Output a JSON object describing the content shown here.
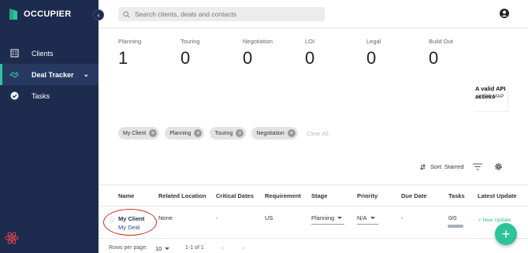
{
  "brand": {
    "name": "OCCUPIER"
  },
  "sidebar": {
    "items": [
      {
        "label": "Clients",
        "icon": "building-icon"
      },
      {
        "label": "Deal Tracker",
        "icon": "handshake-icon"
      },
      {
        "label": "Tasks",
        "icon": "check-circle-icon"
      }
    ]
  },
  "search": {
    "placeholder": "Search clients, deals and contacts"
  },
  "stages": [
    {
      "label": "Planning",
      "count": "1"
    },
    {
      "label": "Touring",
      "count": "0"
    },
    {
      "label": "Negotiation",
      "count": "0"
    },
    {
      "label": "LOI",
      "count": "0"
    },
    {
      "label": "Legal",
      "count": "0"
    },
    {
      "label": "Build Out",
      "count": "0"
    }
  ],
  "map": {
    "error_text": "A valid API access",
    "view_label": "VIEW MAP"
  },
  "filters": {
    "chips": [
      "My Client",
      "Planning",
      "Touring",
      "Negotiation"
    ],
    "clear_label": "Clear All"
  },
  "sort": {
    "label": "Sort: Starred"
  },
  "table": {
    "headers": [
      "Name",
      "Related Location",
      "Critical Dates",
      "Requirement",
      "Stage",
      "Priority",
      "Due Date",
      "Tasks",
      "Latest Update"
    ],
    "rows": [
      {
        "client": "My Client",
        "deal": "My Deal",
        "related_location": "None",
        "critical_dates": "-",
        "requirement": "US",
        "stage": "Planning",
        "priority": "N/A",
        "due_date": "-",
        "tasks": "0/0",
        "latest_update": "+ New Update"
      }
    ]
  },
  "pagination": {
    "rows_label": "Rows per page:",
    "rows_value": "10",
    "range": "1-1 of 1"
  },
  "fab": {
    "label": "+"
  },
  "colors": {
    "sidebar": "#1d2b4f",
    "accent": "#2ec39a",
    "highlight": "#d02a2a"
  }
}
